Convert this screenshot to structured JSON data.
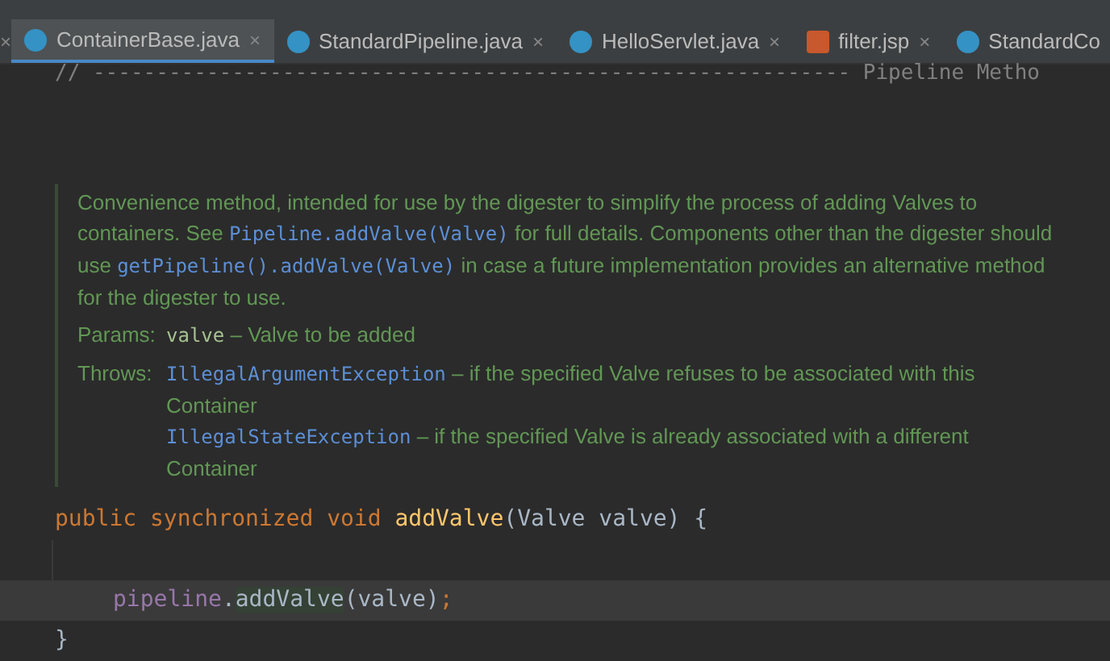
{
  "previous_tab_close": "×",
  "tabs": [
    {
      "label": "ContainerBase.java",
      "kind": "class",
      "selected": true,
      "close": "×"
    },
    {
      "label": "StandardPipeline.java",
      "kind": "class",
      "selected": false,
      "close": "×"
    },
    {
      "label": "HelloServlet.java",
      "kind": "class",
      "selected": false,
      "close": "×"
    },
    {
      "label": "filter.jsp",
      "kind": "jsp",
      "selected": false,
      "close": "×"
    },
    {
      "label": "StandardCo",
      "kind": "class",
      "selected": false
    }
  ],
  "comment_line": "// ------------------------------------------------------------ Pipeline Metho",
  "doc": {
    "description": [
      {
        "kind": "text",
        "text": "Convenience method, intended for use by the digester to simplify the process of adding Valves to containers. See "
      },
      {
        "kind": "code",
        "text": "Pipeline.addValve(Valve)"
      },
      {
        "kind": "text",
        "text": " for full details. Components other than the digester should use "
      },
      {
        "kind": "code",
        "text": "getPipeline().addValve(Valve)"
      },
      {
        "kind": "text",
        "text": " in case a future implementation provides an alternative method for the digester to use."
      }
    ],
    "sections": [
      {
        "label": "Params:",
        "entries": [
          [
            {
              "kind": "param",
              "text": "valve"
            },
            {
              "kind": "text",
              "text": " – Valve to be added"
            }
          ]
        ]
      },
      {
        "label": "Throws:",
        "entries": [
          [
            {
              "kind": "code",
              "text": "IllegalArgumentException"
            },
            {
              "kind": "text",
              "text": " – if the specified Valve refuses to be associated with this Container"
            }
          ],
          [
            {
              "kind": "code",
              "text": "IllegalStateException"
            },
            {
              "kind": "text",
              "text": " – if the specified Valve is already associated with a different Container"
            }
          ]
        ]
      }
    ]
  },
  "code_lines": [
    {
      "tokens": [
        {
          "kind": "keyword",
          "text": "public synchronized void "
        },
        {
          "kind": "method",
          "text": "addValve"
        },
        {
          "kind": "plain",
          "text": "(Valve valve) {"
        }
      ]
    },
    {
      "kind": "blank"
    },
    {
      "current": true,
      "indent": true,
      "tokens": [
        {
          "kind": "field",
          "text": "pipeline"
        },
        {
          "kind": "plain",
          "text": "."
        },
        {
          "kind": "match",
          "text": "addValve"
        },
        {
          "kind": "plain",
          "text": "(valve)"
        },
        {
          "kind": "keyword",
          "text": ";"
        }
      ]
    },
    {
      "tokens": [
        {
          "kind": "plain",
          "text": "}"
        }
      ]
    }
  ]
}
